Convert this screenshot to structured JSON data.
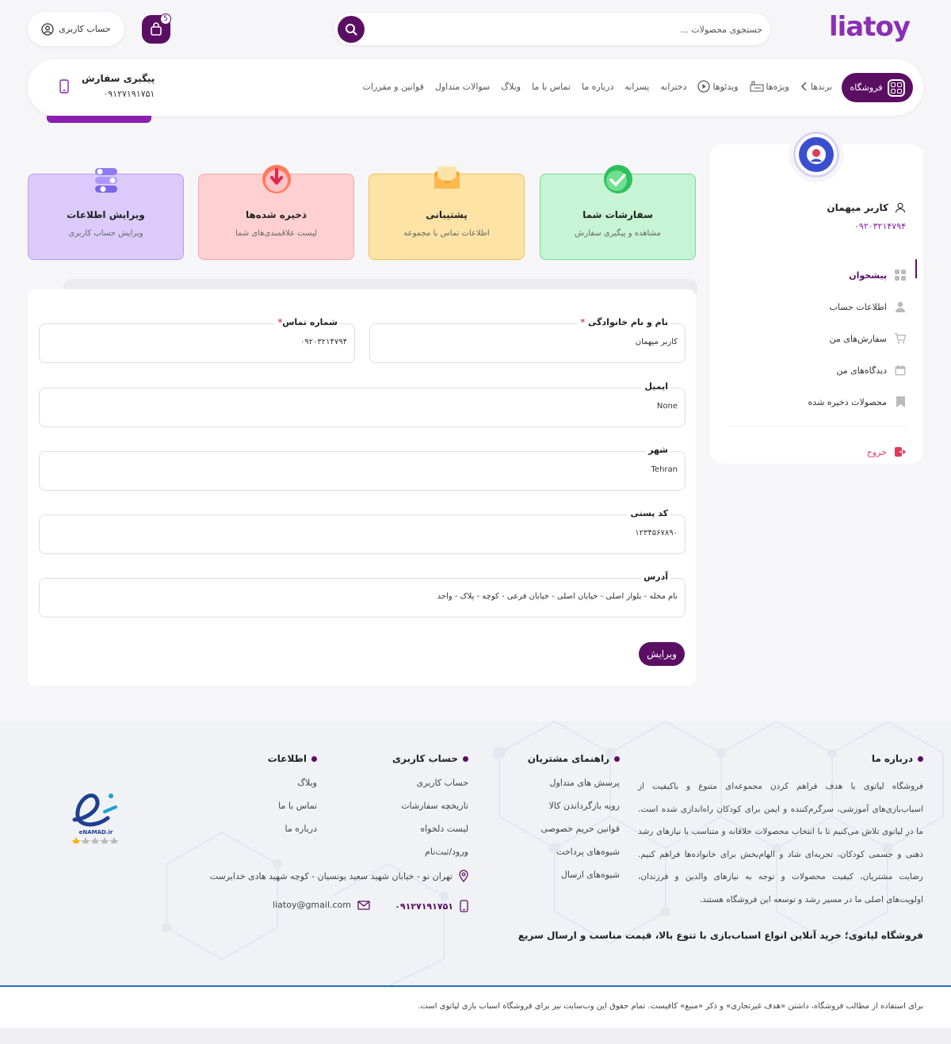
{
  "header": {
    "logo_text": "liatoy",
    "search_placeholder": "جستجوی محصولات ...",
    "cart_count": "5",
    "account_label": "حساب کاربری"
  },
  "nav": {
    "shop_label": "فروشگاه",
    "links": [
      "برندها",
      "ویژه‌ها",
      "ویدئوها",
      "دخترانه",
      "پسرانه",
      "درباره ما",
      "تماس با ما",
      "وبلاگ",
      "سوالات متداول",
      "قوانین و مقررات"
    ],
    "track_title": "پیگیری سفارش",
    "track_phone": "۰۹۱۲۷۱۹۱۷۵۱"
  },
  "sidebar": {
    "user_name": "کاربر میهمان",
    "user_phone": "۰۹۲۰۳۲۱۴۷۹۴",
    "menu": [
      "پیشخوان",
      "اطلاعات حساب",
      "سفارش‌های من",
      "دیدگاه‌های من",
      "محصولات ذخیره شده"
    ],
    "logout": "خروج"
  },
  "cards": [
    {
      "title": "سفارشات شما",
      "subtitle": "مشاهده و پیگیری سفارش"
    },
    {
      "title": "پشتیبانی",
      "subtitle": "اطلاعات تماس با مجموعه"
    },
    {
      "title": "ذخیره شده‌ها",
      "subtitle": "لیست علاقمندی‌های شما"
    },
    {
      "title": "ویرایش اطلاعات",
      "subtitle": "ویرایش حساب کاربری"
    }
  ],
  "form": {
    "name_label": "نام و نام خانوادگی",
    "name_value": "کاربر میهمان",
    "phone_label": "شماره تماس",
    "phone_value": "۰۹۲۰۳۲۱۴۷۹۴",
    "email_label": "ایمیل",
    "email_value": "None",
    "city_label": "شهر",
    "city_value": "Tehran",
    "postal_label": "کد پستی",
    "postal_value": "۱۲۳۴۵۶۷۸۹۰",
    "address_label": "آدرس",
    "address_value": "نام محله - بلوار اصلی - خیابان اصلی - خیابان فرعی - کوچه - پلاک - واحد",
    "required_mark": "*",
    "edit_label": "ویرایش"
  },
  "footer": {
    "about_title": "درباره ما",
    "about_text": "فروشگاه لیاتوی با هدف فراهم کردن مجموعه‌ای متنوع و باکیفیت از اسباب‌بازی‌های آموزشی، سرگرم‌کننده و ایمن برای کودکان راه‌اندازی شده است. ما در لیاتوی تلاش می‌کنیم تا با انتخاب محصولات خلاقانه و متناسب با نیازهای رشد ذهنی و جسمی کودکان، تجربه‌ای شاد و الهام‌بخش برای خانواده‌ها فراهم کنیم. رضایت مشتریان، کیفیت محصولات و توجه به نیازهای والدین و فرزندان، اولویت‌های اصلی ما در مسیر رشد و توسعه این فروشگاه هستند.",
    "guide_title": "راهنمای مشتریان",
    "guide_links": [
      "پرسش های متداول",
      "رویه بازگرداندن کالا",
      "قوانین حریم خصوصی",
      "شیوه‌های پرداخت",
      "شیوه‌های ارسال"
    ],
    "account_title": "حساب کاربری",
    "account_links": [
      "حساب کاربری",
      "تاریخچه سفارشات",
      "لیست دلخواه",
      "ورود/ثبت‌نام"
    ],
    "info_title": "اطلاعات",
    "info_links": [
      "وبلاگ",
      "تماس با ما",
      "درباره ما"
    ],
    "address": "تهران نو - خیابان شهید سعید یونسیان - کوچه شهید هادی خدایرست",
    "phone": "۰۹۱۲۷۱۹۱۷۵۱",
    "email": "liatoy@gmail.com",
    "slogan": "فروشگاه لیاتوی؛ خرید آنلاین انواع اسباب‌بازی با تنوع بالا، قیمت مناسب و ارسال سریع",
    "enamad_label": "eNAMAD.ir",
    "copyright": "برای استفاده از مطالب فروشگاه، داشتن «هدف غیرتجاری» و ذکر «منبع» کافیست. تمام حقوق این وب‌سایت نیز برای فروشگاه اسباب بازی لیاتوی است."
  },
  "colors": {
    "primary": "#5b0f63",
    "accent": "#8a1fb0",
    "danger": "#e03c5a"
  }
}
